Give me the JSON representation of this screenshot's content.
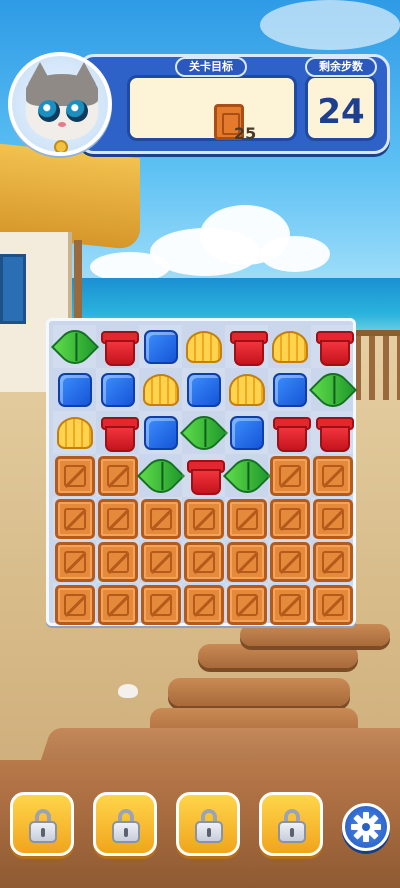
{
  "hud": {
    "target_title": "关卡目标",
    "moves_title": "剩余步数",
    "target_count": "25",
    "moves_left": "24",
    "target_icon": "crate-icon"
  },
  "board": {
    "rows": 7,
    "cols": 7,
    "tiles": [
      [
        "leaf",
        "pot",
        "cube",
        "shell",
        "pot",
        "shell",
        "pot"
      ],
      [
        "cube",
        "cube",
        "shell",
        "cube",
        "shell",
        "cube",
        "leaf"
      ],
      [
        "shell",
        "pot",
        "cube",
        "leaf",
        "cube",
        "pot",
        "pot"
      ],
      [
        "crate",
        "crate",
        "leaf",
        "pot",
        "leaf",
        "crate",
        "crate"
      ],
      [
        "crate",
        "crate",
        "crate",
        "crate",
        "crate",
        "crate",
        "crate"
      ],
      [
        "crate",
        "crate",
        "crate",
        "crate",
        "crate",
        "crate",
        "crate"
      ],
      [
        "crate",
        "crate",
        "crate",
        "crate",
        "crate",
        "crate",
        "crate"
      ]
    ]
  },
  "boosters": [
    {
      "icon": "lock-icon",
      "locked": true
    },
    {
      "icon": "lock-icon",
      "locked": true
    },
    {
      "icon": "lock-icon",
      "locked": true
    },
    {
      "icon": "lock-icon",
      "locked": true
    }
  ],
  "settings": {
    "icon": "gear-icon"
  },
  "colors": {
    "hud_blue": "#2f62c8",
    "crate_orange": "#e58a3a",
    "booster_yellow": "#f0a51d"
  }
}
